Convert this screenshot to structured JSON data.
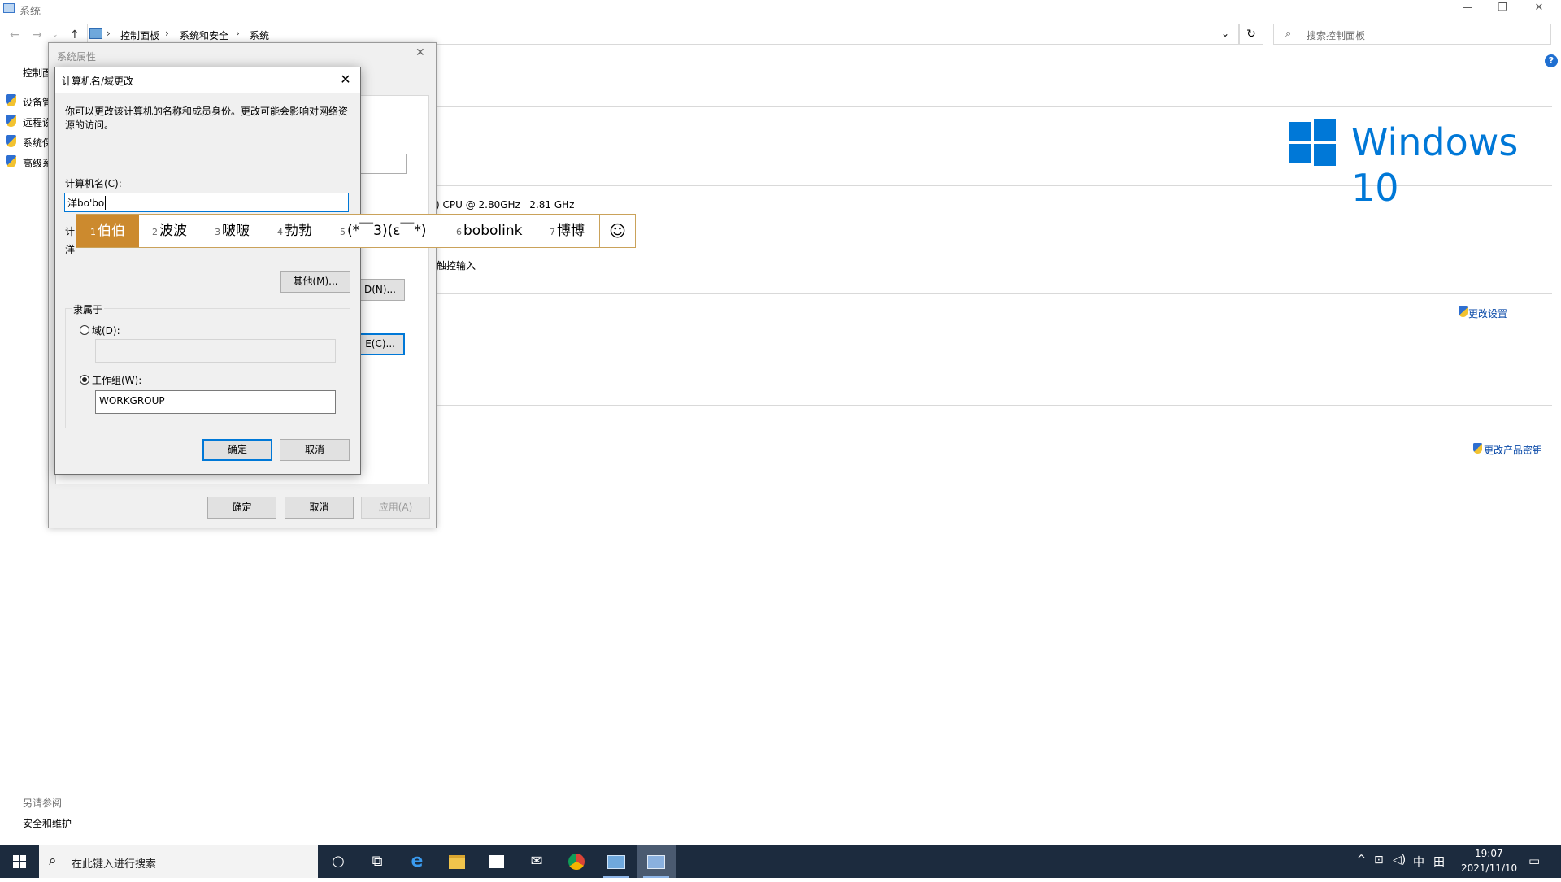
{
  "window": {
    "title": "系统",
    "controls": {
      "minimize": "—",
      "maximize": "❐",
      "close": "✕"
    }
  },
  "address_bar": {
    "breadcrumb": [
      "控制面板",
      "系统和安全",
      "系统"
    ],
    "refresh": "↻",
    "search_placeholder": "搜索控制面板"
  },
  "sidebar": {
    "home_label": "控制面",
    "items": [
      {
        "label": "设备管"
      },
      {
        "label": "远程设"
      },
      {
        "label": "系统保"
      },
      {
        "label": "高级系"
      }
    ],
    "see_also_title": "另请参阅",
    "see_also_link": "安全和维护"
  },
  "main": {
    "cpu_text": ") CPU @ 2.80GHz   2.81 GHz",
    "touch_text": "触控输入",
    "change_settings": "更改设置",
    "change_product_key": "更改产品密钥",
    "windows_logo_text": "Windows 10",
    "help_icon": "?"
  },
  "system_properties": {
    "title": "系统属性",
    "close": "✕",
    "partial_button_1": "D(N)...",
    "partial_button_2": "E(C)...",
    "ok": "确定",
    "cancel": "取消",
    "apply": "应用(A)"
  },
  "name_dialog": {
    "title": "计算机名/域更改",
    "close": "✕",
    "description": "你可以更改该计算机的名称和成员身份。更改可能会影响对网络资源的访问。",
    "computer_name_label": "计算机名(C):",
    "computer_name_value": "洋bo'bo",
    "fullname_label_fragment": "计",
    "fullname_value_fragment": "洋",
    "more_button": "其他(M)...",
    "member_of": "隶属于",
    "domain_label": "域(D):",
    "domain_value": "",
    "workgroup_label": "工作组(W):",
    "workgroup_value": "WORKGROUP",
    "selected_membership": "workgroup",
    "ok": "确定",
    "cancel": "取消"
  },
  "ime": {
    "candidates": [
      {
        "num": "1",
        "text": "伯伯",
        "selected": true
      },
      {
        "num": "2",
        "text": "波波"
      },
      {
        "num": "3",
        "text": "啵啵"
      },
      {
        "num": "4",
        "text": "勃勃"
      },
      {
        "num": "5",
        "text": "(*￣3)(ε￣*)"
      },
      {
        "num": "6",
        "text": "bobolink"
      },
      {
        "num": "7",
        "text": "博博"
      }
    ],
    "emoji_icon": "☺"
  },
  "taskbar": {
    "search_placeholder": "在此键入进行搜索",
    "apps": [
      "cortana-icon",
      "task-view-icon",
      "edge-icon",
      "file-explorer-icon",
      "store-icon",
      "mail-icon",
      "chrome-icon",
      "control-panel-icon",
      "system-settings-icon"
    ],
    "tray": {
      "chevron": "^",
      "input_lang": "中",
      "ime_mode": "田",
      "time": "19:07",
      "date": "2021/11/10"
    }
  },
  "colors": {
    "accent": "#0078d7",
    "ime_selected": "#cc8a2e",
    "taskbar": "#1c2b3e"
  }
}
